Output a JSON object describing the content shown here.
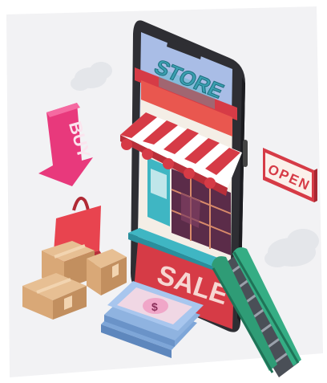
{
  "illustration": {
    "store_sign_text": "STORE",
    "open_sign_text": "OPEN",
    "buy_tag_text": "BUY",
    "sale_text": "SALE",
    "coin_symbol": "$"
  },
  "colors": {
    "phone_body": "#2e2e33",
    "screen_sky": "#a9bde6",
    "store_red": "#d63b46",
    "awning_white": "#ffffff",
    "teal": "#3fb6c3",
    "buy_pink": "#e8397c",
    "bag_red": "#e8444f",
    "box_tan": "#d9a877",
    "escalator_green": "#2f9c76",
    "cash_blue": "#8fb3e0"
  }
}
